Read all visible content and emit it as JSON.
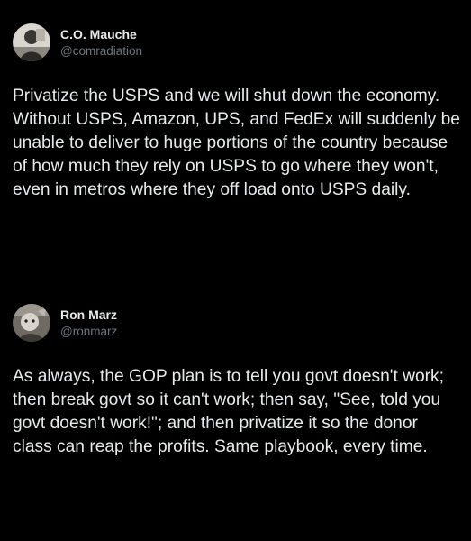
{
  "posts": [
    {
      "display_name": "C.O. Mauche",
      "handle": "@comradiation",
      "text": "Privatize the USPS and we will shut down the economy. Without USPS, Amazon, UPS, and FedEx will suddenly be unable to deliver to huge portions of the country because of how much they rely on USPS to go where they won't, even in metros where they off load onto USPS daily.",
      "avatar_icon": "profile-photo-icon"
    },
    {
      "display_name": "Ron Marz",
      "handle": "@ronmarz",
      "text": "As always, the GOP plan is to tell you govt doesn't work; then break govt so it can't work; then say, \"See, told you govt doesn't work!\"; and then privatize it so the donor class can reap the profits. Same playbook, every time.",
      "avatar_icon": "profile-photo-icon"
    }
  ],
  "colors": {
    "background": "#000000",
    "text": "#e7e9ea",
    "handle": "#71767b"
  }
}
